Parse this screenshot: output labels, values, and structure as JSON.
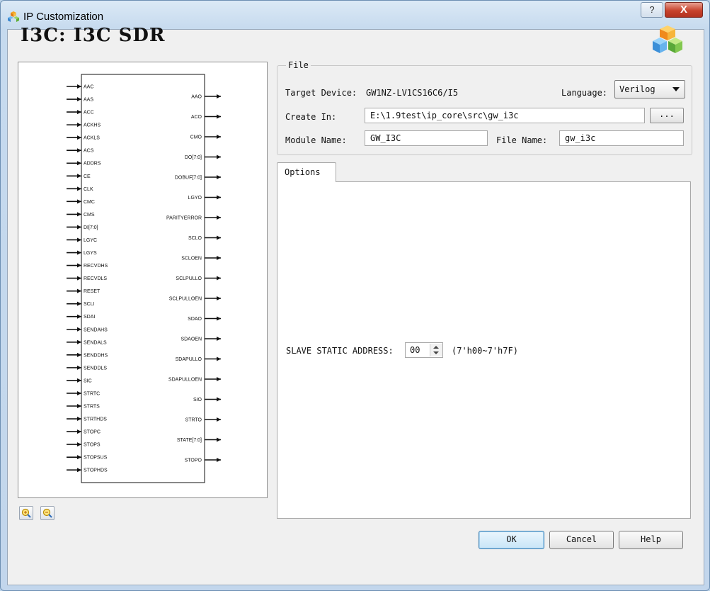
{
  "window": {
    "title": "IP Customization",
    "help_symbol": "?",
    "close_symbol": "X"
  },
  "header": {
    "title": "I3C: I3C SDR"
  },
  "symbol": {
    "inputs": [
      "AAC",
      "AAS",
      "ACC",
      "ACKHS",
      "ACKLS",
      "ACS",
      "ADDRS",
      "CE",
      "CLK",
      "CMC",
      "CMS",
      "DI[7:0]",
      "LGYC",
      "LGYS",
      "RECVDHS",
      "RECVDLS",
      "RESET",
      "SCLI",
      "SDAI",
      "SENDAHS",
      "SENDALS",
      "SENDDHS",
      "SENDDLS",
      "SIC",
      "STRTC",
      "STRTS",
      "STRTHDS",
      "STOPC",
      "STOPS",
      "STOPSUS",
      "STOPHDS"
    ],
    "outputs": [
      "AAO",
      "ACO",
      "CMO",
      "DO[7:0]",
      "DOBUF[7:0]",
      "LGYO",
      "PARITYERROR",
      "SCLO",
      "SCLOEN",
      "SCLPULLO",
      "SCLPULLOEN",
      "SDAO",
      "SDAOEN",
      "SDAPULLO",
      "SDAPULLOEN",
      "SIO",
      "STRTO",
      "STATE[7:0]",
      "STOPO"
    ]
  },
  "file": {
    "group_title": "File",
    "target_label": "Target Device:",
    "target_value": "GW1NZ-LV1CS16C6/I5",
    "language_label": "Language:",
    "language_value": "Verilog",
    "create_label": "Create In:",
    "create_value": "E:\\1.9test\\ip_core\\src\\gw_i3c",
    "browse_label": "...",
    "module_label": "Module Name:",
    "module_value": "GW_I3C",
    "filename_label": "File Name:",
    "filename_value": "gw_i3c"
  },
  "options": {
    "tab_label": "Options",
    "address_label": "SLAVE STATIC ADDRESS:",
    "address_value": "00",
    "address_range": "(7'h00~7'h7F)"
  },
  "buttons": {
    "ok": "OK",
    "cancel": "Cancel",
    "help": "Help"
  }
}
